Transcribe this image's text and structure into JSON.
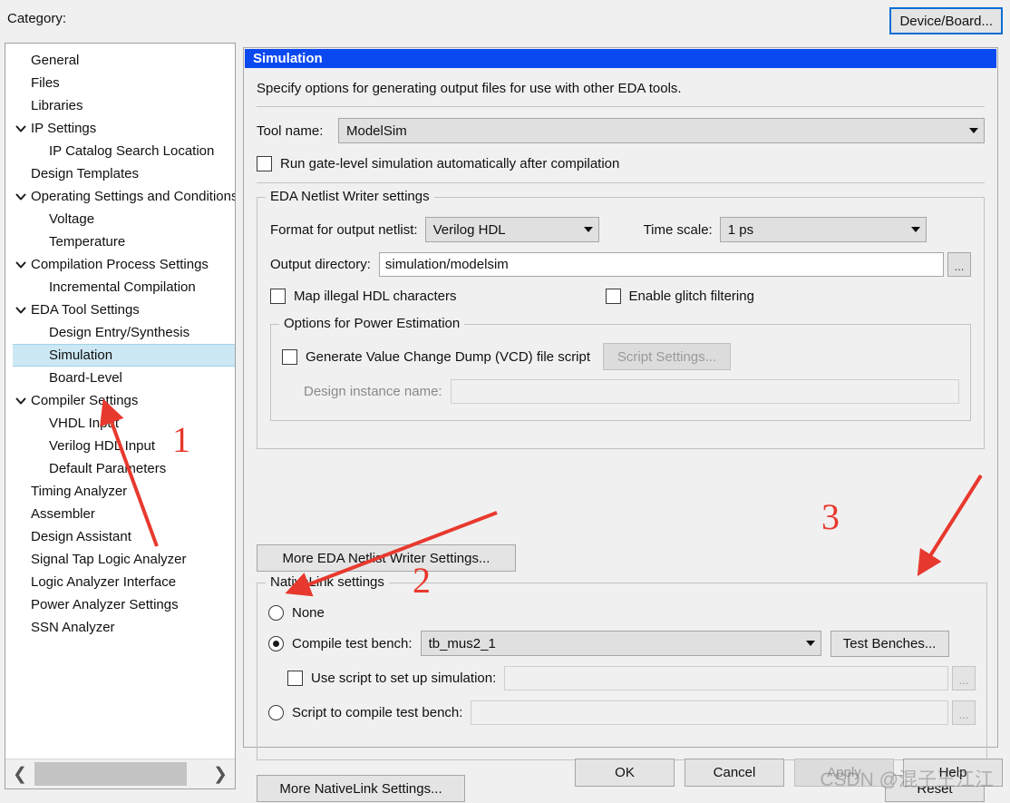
{
  "window": {
    "category_label": "Category:",
    "device_board_button": "Device/Board..."
  },
  "sidebar": {
    "items": [
      {
        "label": "General",
        "depth": 0,
        "expander": "none",
        "selected": false
      },
      {
        "label": "Files",
        "depth": 0,
        "expander": "none",
        "selected": false
      },
      {
        "label": "Libraries",
        "depth": 0,
        "expander": "none",
        "selected": false
      },
      {
        "label": "IP Settings",
        "depth": 0,
        "expander": "expanded",
        "selected": false
      },
      {
        "label": "IP Catalog Search Location",
        "depth": 1,
        "expander": "none",
        "selected": false
      },
      {
        "label": "Design Templates",
        "depth": 0,
        "expander": "none",
        "selected": false
      },
      {
        "label": "Operating Settings and Conditions",
        "depth": 0,
        "expander": "expanded",
        "selected": false
      },
      {
        "label": "Voltage",
        "depth": 1,
        "expander": "none",
        "selected": false
      },
      {
        "label": "Temperature",
        "depth": 1,
        "expander": "none",
        "selected": false
      },
      {
        "label": "Compilation Process Settings",
        "depth": 0,
        "expander": "expanded",
        "selected": false
      },
      {
        "label": "Incremental Compilation",
        "depth": 1,
        "expander": "none",
        "selected": false
      },
      {
        "label": "EDA Tool Settings",
        "depth": 0,
        "expander": "expanded",
        "selected": false
      },
      {
        "label": "Design Entry/Synthesis",
        "depth": 1,
        "expander": "none",
        "selected": false
      },
      {
        "label": "Simulation",
        "depth": 1,
        "expander": "none",
        "selected": true
      },
      {
        "label": "Board-Level",
        "depth": 1,
        "expander": "none",
        "selected": false
      },
      {
        "label": "Compiler Settings",
        "depth": 0,
        "expander": "expanded",
        "selected": false
      },
      {
        "label": "VHDL Input",
        "depth": 1,
        "expander": "none",
        "selected": false
      },
      {
        "label": "Verilog HDL Input",
        "depth": 1,
        "expander": "none",
        "selected": false
      },
      {
        "label": "Default Parameters",
        "depth": 1,
        "expander": "none",
        "selected": false
      },
      {
        "label": "Timing Analyzer",
        "depth": 0,
        "expander": "none",
        "selected": false
      },
      {
        "label": "Assembler",
        "depth": 0,
        "expander": "none",
        "selected": false
      },
      {
        "label": "Design Assistant",
        "depth": 0,
        "expander": "none",
        "selected": false
      },
      {
        "label": "Signal Tap Logic Analyzer",
        "depth": 0,
        "expander": "none",
        "selected": false
      },
      {
        "label": "Logic Analyzer Interface",
        "depth": 0,
        "expander": "none",
        "selected": false
      },
      {
        "label": "Power Analyzer Settings",
        "depth": 0,
        "expander": "none",
        "selected": false
      },
      {
        "label": "SSN Analyzer",
        "depth": 0,
        "expander": "none",
        "selected": false
      }
    ]
  },
  "panel": {
    "title": "Simulation",
    "description": "Specify options for generating output files for use with other EDA tools.",
    "tool_name_label": "Tool name:",
    "tool_name_value": "ModelSim",
    "run_gate_level_label": "Run gate-level simulation automatically after compilation",
    "run_gate_level_checked": false,
    "eda_group": {
      "title": "EDA Netlist Writer settings",
      "format_label": "Format for output netlist:",
      "format_value": "Verilog HDL",
      "timescale_label": "Time scale:",
      "timescale_value": "1 ps",
      "output_dir_label": "Output directory:",
      "output_dir_value": "simulation/modelsim",
      "browse_label": "...",
      "map_illegal_label": "Map illegal HDL characters",
      "map_illegal_checked": false,
      "glitch_label": "Enable glitch filtering",
      "glitch_checked": false,
      "power_group": {
        "title": "Options for Power Estimation",
        "vcd_label": "Generate Value Change Dump (VCD) file script",
        "vcd_checked": false,
        "script_settings_button": "Script Settings...",
        "design_instance_label": "Design instance name:",
        "design_instance_value": ""
      }
    },
    "more_eda_button": "More EDA Netlist Writer Settings...",
    "nativelink_group": {
      "title": "NativeLink settings",
      "none_label": "None",
      "none_selected": false,
      "compile_tb_label": "Compile test bench:",
      "compile_tb_selected": true,
      "compile_tb_value": "tb_mus2_1",
      "test_benches_button": "Test Benches...",
      "use_script_label": "Use script to set up simulation:",
      "use_script_checked": false,
      "use_script_value": "",
      "script_compile_label": "Script to compile test bench:",
      "script_compile_selected": false,
      "script_compile_value": "",
      "browse_label": "..."
    },
    "more_nativelink_button": "More NativeLink Settings...",
    "reset_button": "Reset"
  },
  "dialog_buttons": {
    "ok": "OK",
    "cancel": "Cancel",
    "apply": "Apply",
    "apply_disabled": true,
    "help": "Help"
  },
  "annotations": {
    "numbers": [
      {
        "text": "1"
      },
      {
        "text": "2"
      },
      {
        "text": "3"
      }
    ],
    "color": "#e8392e"
  },
  "watermark": "CSDN @混子王江江"
}
